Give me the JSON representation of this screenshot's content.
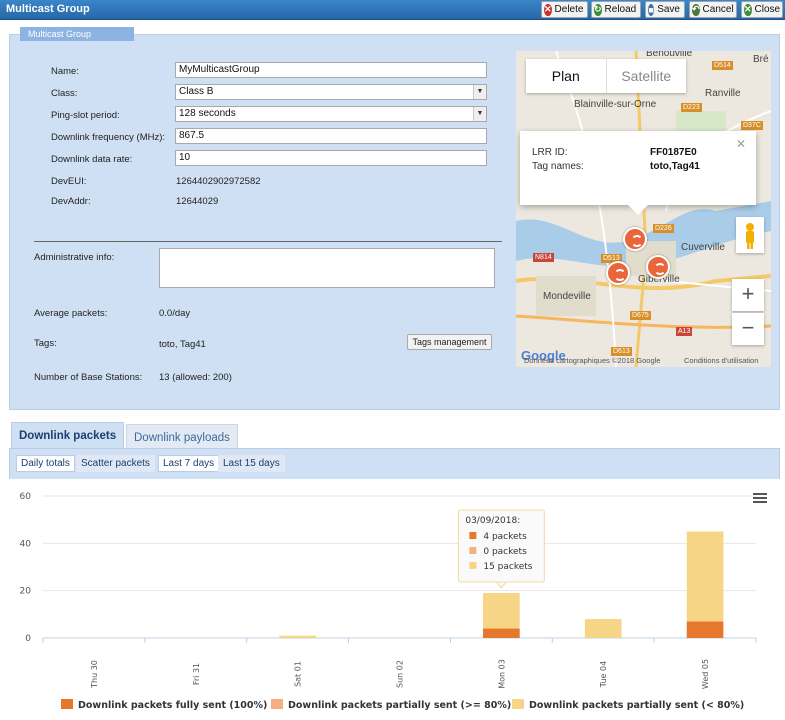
{
  "window": {
    "title": "Multicast Group"
  },
  "toolbar": [
    {
      "label": "Delete",
      "icon": "delete-icon",
      "color": "#c8302a",
      "glyph": "✕"
    },
    {
      "label": "Reload",
      "icon": "reload-icon",
      "color": "#3a8b3a",
      "glyph": "↻"
    },
    {
      "label": "Save",
      "icon": "save-icon",
      "color": "#3f6ea8",
      "glyph": "■"
    },
    {
      "label": "Cancel",
      "icon": "cancel-icon",
      "color": "#4a7a3a",
      "glyph": "↶"
    },
    {
      "label": "Close",
      "icon": "close-icon",
      "color": "#3a8b3a",
      "glyph": "✕"
    }
  ],
  "section": {
    "legend": "Multicast Group"
  },
  "form": {
    "name_label": "Name:",
    "name_value": "MyMulticastGroup",
    "class_label": "Class:",
    "class_value": "Class B",
    "ping_label": "Ping-slot period:",
    "ping_value": "128 seconds",
    "freq_label": "Downlink frequency (MHz):",
    "freq_value": "867.5",
    "rate_label": "Downlink data rate:",
    "rate_value": "10",
    "deveui_label": "DevEUI:",
    "deveui_value": "1264402902972582",
    "devaddr_label": "DevAddr:",
    "devaddr_value": "12644029",
    "admin_label": "Administrative info:",
    "avg_label": "Average packets:",
    "avg_value": "0.0/day",
    "tags_label": "Tags:",
    "tags_value": "toto, Tag41",
    "tags_button": "Tags management",
    "bs_label": "Number of Base Stations:",
    "bs_value": "13 (allowed: 200)"
  },
  "map": {
    "tab_plan": "Plan",
    "tab_satellite": "Satellite",
    "places": [
      "Bénouville",
      "Blainville-sur-Orne",
      "Ranville",
      "Cuverville",
      "Mondeville",
      "Giberville",
      "Bré"
    ],
    "roads": [
      "D514",
      "D223",
      "D37C",
      "D226",
      "D513",
      "N814",
      "D675",
      "A13",
      "D613"
    ],
    "info_lrr_label": "LRR ID:",
    "info_lrr_value": "FF0187E0",
    "info_tags_label": "Tag names:",
    "info_tags_value": "toto,Tag41",
    "zoom_in": "+",
    "zoom_out": "−",
    "attribution": "Données cartographiques ©2018 Google",
    "terms": "Conditions d'utilisation",
    "logo": "Google",
    "marker_color": "#e8663a"
  },
  "tabs": {
    "packets": "Downlink packets",
    "payloads": "Downlink payloads"
  },
  "subtabs": {
    "daily": "Daily totals",
    "scatter": "Scatter packets",
    "last7": "Last 7 days",
    "last15": "Last 15 days"
  },
  "chart_data": {
    "type": "bar",
    "stacked": true,
    "categories": [
      "Thu 30",
      "Fri 31",
      "Sat 01",
      "Sun 02",
      "Mon 03",
      "Tue 04",
      "Wed 05"
    ],
    "series": [
      {
        "name": "Downlink packets fully sent (100%)",
        "color": "#e8772e",
        "values": [
          0,
          0,
          0,
          0,
          4,
          0,
          7
        ]
      },
      {
        "name": "Downlink packets partially sent (>= 80%)",
        "color": "#f4b07f",
        "values": [
          0,
          0,
          0,
          0,
          0,
          0,
          0
        ]
      },
      {
        "name": "Downlink packets partially sent (< 80%)",
        "color": "#f7d587",
        "values": [
          0,
          0,
          1,
          0,
          15,
          8,
          38
        ]
      }
    ],
    "yticks": [
      0,
      20,
      40,
      60
    ],
    "ylim": [
      0,
      60
    ],
    "grid": true,
    "legend": "bottom",
    "tooltip": {
      "title": "03/09/2018:",
      "rows": [
        "4 packets",
        "0 packets",
        "15 packets"
      ]
    }
  }
}
